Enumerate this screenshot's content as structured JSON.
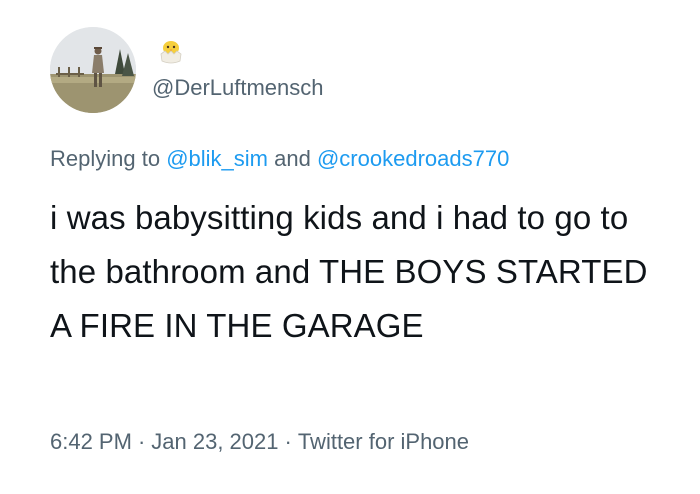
{
  "tweet": {
    "author": {
      "handle": "@DerLuftmensch",
      "badge_icon": "hatching-chick-emoji-icon"
    },
    "reply": {
      "prefix": "Replying to",
      "mention_1": "@blik_sim",
      "connector": "and",
      "mention_2": "@crookedroads770"
    },
    "body": "i was babysitting kids and i had to go to the bathroom and THE BOYS STARTED A FIRE IN THE GARAGE",
    "meta": {
      "time": "6:42 PM",
      "separator": "·",
      "date": "Jan 23, 2021",
      "client": "Twitter for iPhone"
    }
  },
  "colors": {
    "text": "#0f1419",
    "muted": "#536471",
    "link": "#1d9bf0",
    "background": "#ffffff"
  }
}
